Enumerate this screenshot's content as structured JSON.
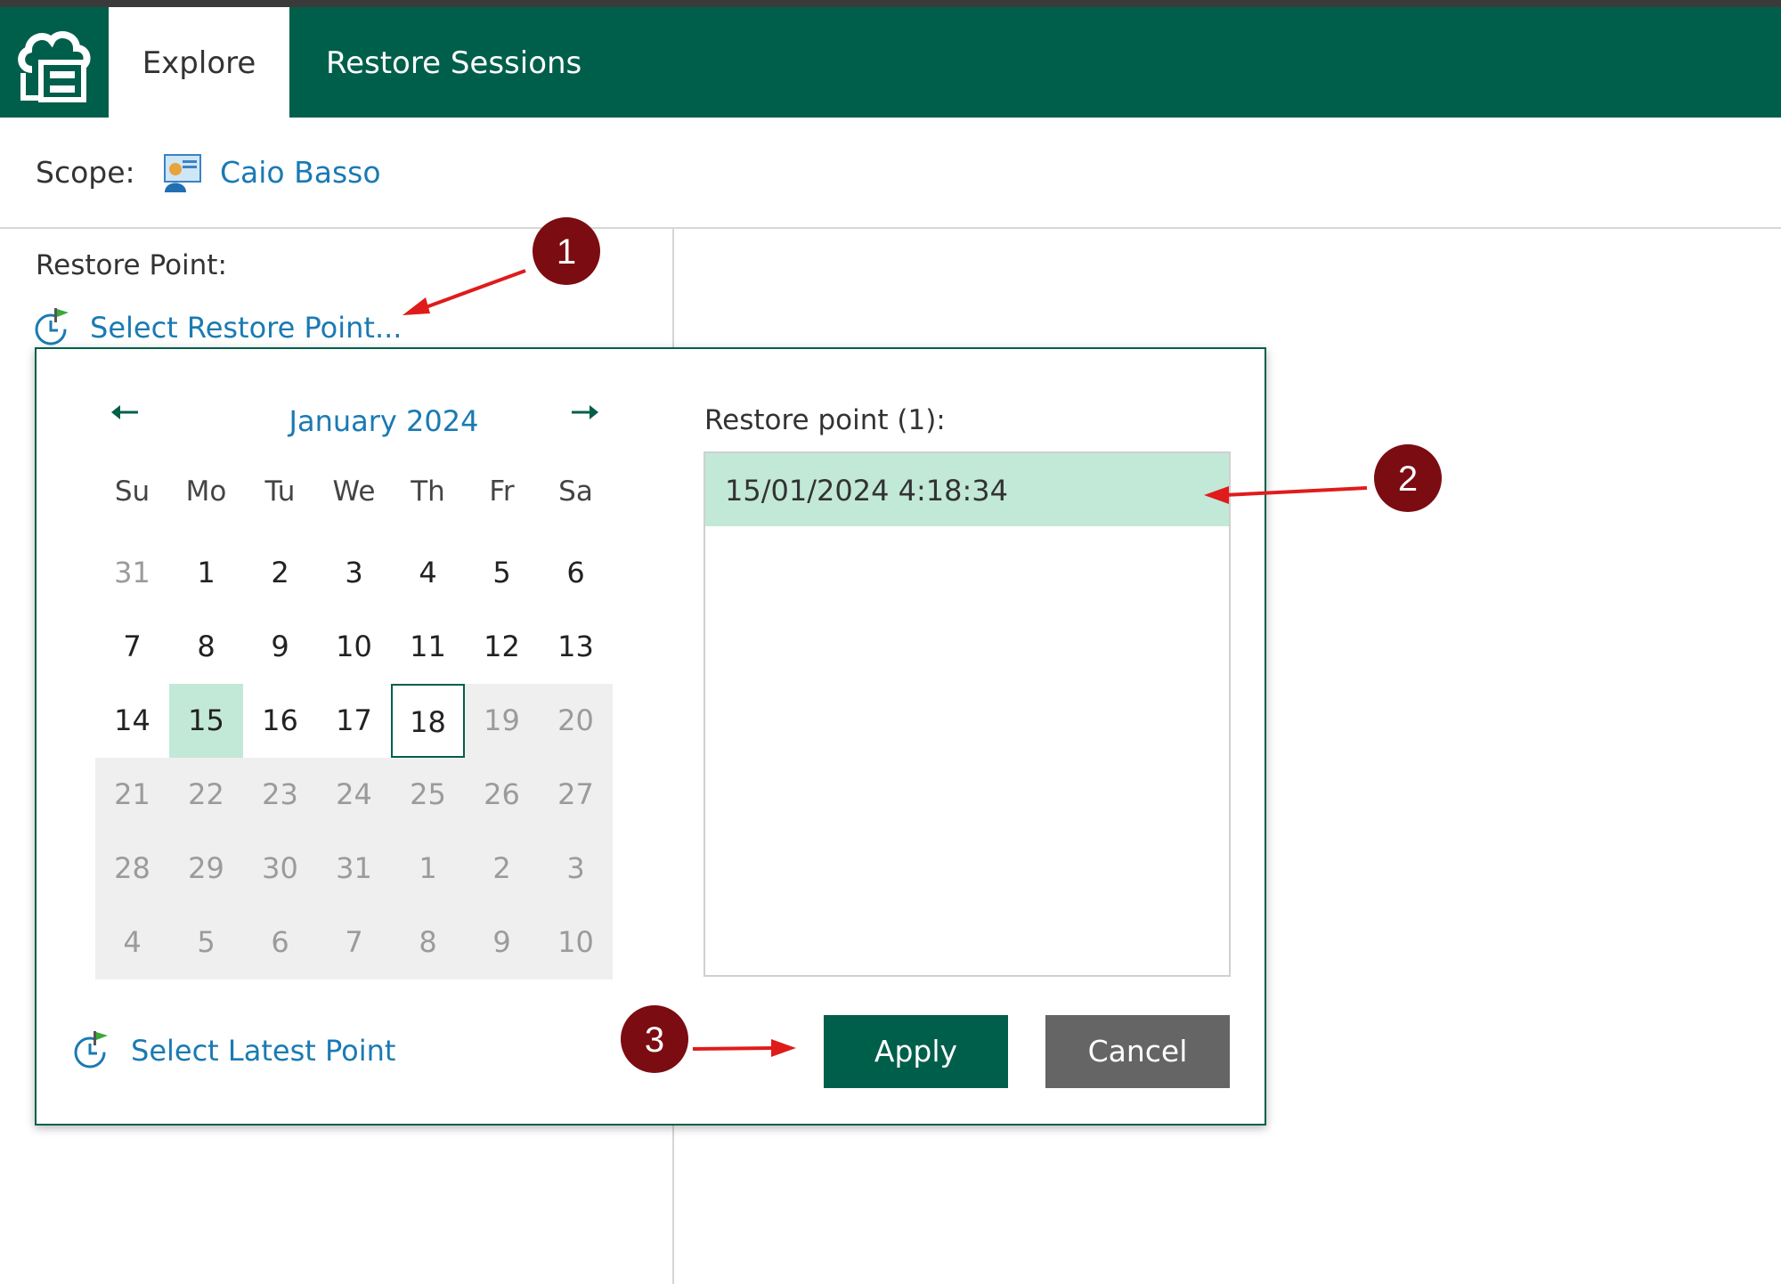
{
  "header": {
    "logo_icon": "veeam-cloud-explorer-icon",
    "tabs": [
      {
        "label": "Explore",
        "active": true
      },
      {
        "label": "Restore Sessions",
        "active": false
      }
    ]
  },
  "scope": {
    "label": "Scope:",
    "user_icon": "user-icon",
    "user": "Caio Basso"
  },
  "restore_point": {
    "label": "Restore Point:",
    "select_link": "Select Restore Point..."
  },
  "calendar": {
    "month": "January 2024",
    "weekdays": [
      "Su",
      "Mo",
      "Tu",
      "We",
      "Th",
      "Fr",
      "Sa"
    ],
    "weeks": [
      [
        "31",
        "1",
        "2",
        "3",
        "4",
        "5",
        "6"
      ],
      [
        "7",
        "8",
        "9",
        "10",
        "11",
        "12",
        "13"
      ],
      [
        "14",
        "15",
        "16",
        "17",
        "18",
        "19",
        "20"
      ],
      [
        "21",
        "22",
        "23",
        "24",
        "25",
        "26",
        "27"
      ],
      [
        "28",
        "29",
        "30",
        "31",
        "1",
        "2",
        "3"
      ],
      [
        "4",
        "5",
        "6",
        "7",
        "8",
        "9",
        "10"
      ]
    ],
    "selected_day": "15",
    "today": "18"
  },
  "restore_list": {
    "label": "Restore point (1):",
    "items": [
      "15/01/2024 4:18:34"
    ]
  },
  "actions": {
    "latest": "Select Latest Point",
    "apply": "Apply",
    "cancel": "Cancel"
  },
  "annotations": {
    "markers": [
      "1",
      "2",
      "3"
    ],
    "marker_color": "#7b0c12",
    "arrow_color": "#e01b1b"
  },
  "colors": {
    "brand": "#005f4b",
    "link": "#1a7ab3",
    "selection": "#c2e8d8"
  }
}
